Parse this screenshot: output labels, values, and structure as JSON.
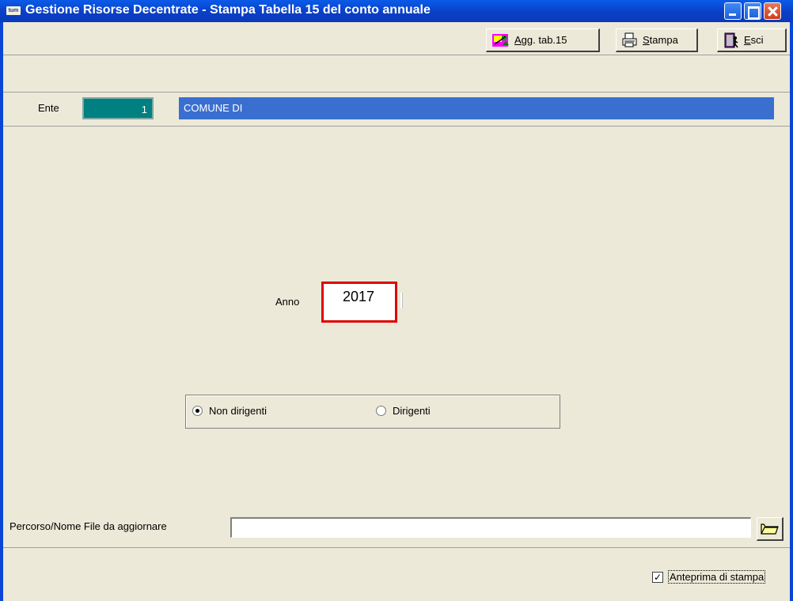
{
  "window": {
    "title": "Gestione Risorse Decentrate - Stampa Tabella 15 del conto annuale",
    "app_icon_text": "tum"
  },
  "toolbar": {
    "agg_label_underlined": "A",
    "agg_label_rest": "gg. tab.15",
    "stampa_label_underlined": "S",
    "stampa_label_rest": "tampa",
    "esci_label_underlined": "E",
    "esci_label_rest": "sci"
  },
  "ente": {
    "label": "Ente",
    "code": "1",
    "name": "COMUNE DI"
  },
  "form": {
    "anno_label": "Anno",
    "anno_value": "2017",
    "radio_non_dirigenti": "Non dirigenti",
    "radio_dirigenti": "Dirigenti",
    "selected": "non_dirigenti",
    "path_label": "Percorso/Nome File da aggiornare",
    "path_value": ""
  },
  "footer": {
    "preview_label": "Anteprima di stampa",
    "preview_checked": true
  },
  "colors": {
    "titlebar": "#0a46d6",
    "ente_code_bg": "#008080",
    "ente_name_bg": "#3a6fd0",
    "anno_highlight": "#e00000"
  }
}
